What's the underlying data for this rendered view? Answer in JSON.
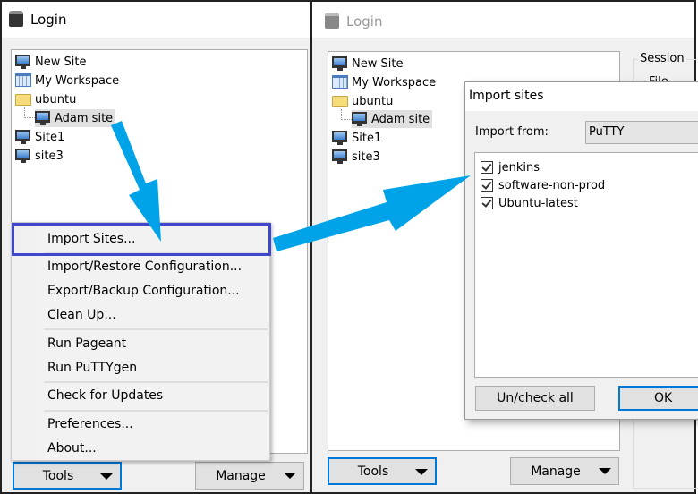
{
  "left_window": {
    "title": "Login",
    "tree": [
      {
        "label": "New Site",
        "icon": "new-site-icon"
      },
      {
        "label": "My Workspace",
        "icon": "workspace-icon"
      },
      {
        "label": "ubuntu",
        "icon": "folder-icon"
      },
      {
        "label": "Adam site",
        "icon": "computer-icon",
        "selected": true
      },
      {
        "label": "Site1",
        "icon": "computer-icon"
      },
      {
        "label": "site3",
        "icon": "computer-icon"
      }
    ],
    "menu": [
      "Import Sites...",
      "Import/Restore Configuration...",
      "Export/Backup Configuration...",
      "Clean Up...",
      "Run Pageant",
      "Run PuTTYgen",
      "Check for Updates",
      "Preferences...",
      "About..."
    ],
    "tools_label": "Tools",
    "manage_label": "Manage"
  },
  "right_window": {
    "title": "Login",
    "tree": [
      {
        "label": "New Site"
      },
      {
        "label": "My Workspace"
      },
      {
        "label": "ubuntu"
      },
      {
        "label": "Adam site",
        "selected": true
      },
      {
        "label": "Site1"
      },
      {
        "label": "site3"
      }
    ],
    "session_group": "Session",
    "session_field_partial": "File proto",
    "tools_label": "Tools",
    "manage_label": "Manage"
  },
  "dialog": {
    "title": "Import sites",
    "import_from_label": "Import from:",
    "import_from_value": "PuTTY",
    "sites": [
      {
        "label": "jenkins",
        "checked": true
      },
      {
        "label": "software-non-prod",
        "checked": true
      },
      {
        "label": "Ubuntu-latest",
        "checked": true
      }
    ],
    "uncheck_all_label": "Un/check all",
    "ok_label": "OK"
  },
  "colors": {
    "arrow": "#00a2e8",
    "highlight_box": "#3f48cc",
    "focus": "#0078d7"
  }
}
